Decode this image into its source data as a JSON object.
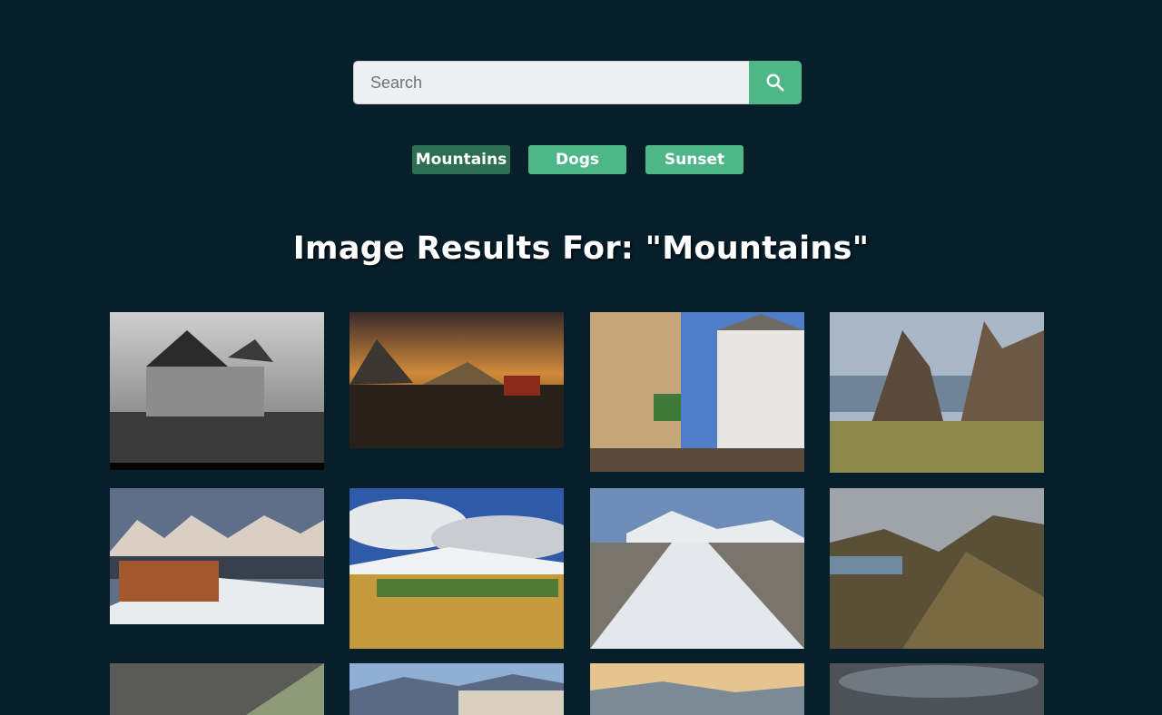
{
  "search": {
    "placeholder": "Search",
    "value": ""
  },
  "icons": {
    "search": "search-icon"
  },
  "colors": {
    "background": "#071e2b",
    "accent": "#4fb688",
    "accent_active": "#2c6f54"
  },
  "chips": [
    {
      "label": "Mountains",
      "active": true
    },
    {
      "label": "Dogs",
      "active": false
    },
    {
      "label": "Sunset",
      "active": false
    }
  ],
  "results": {
    "title": "Image Results For: \"Mountains\""
  }
}
